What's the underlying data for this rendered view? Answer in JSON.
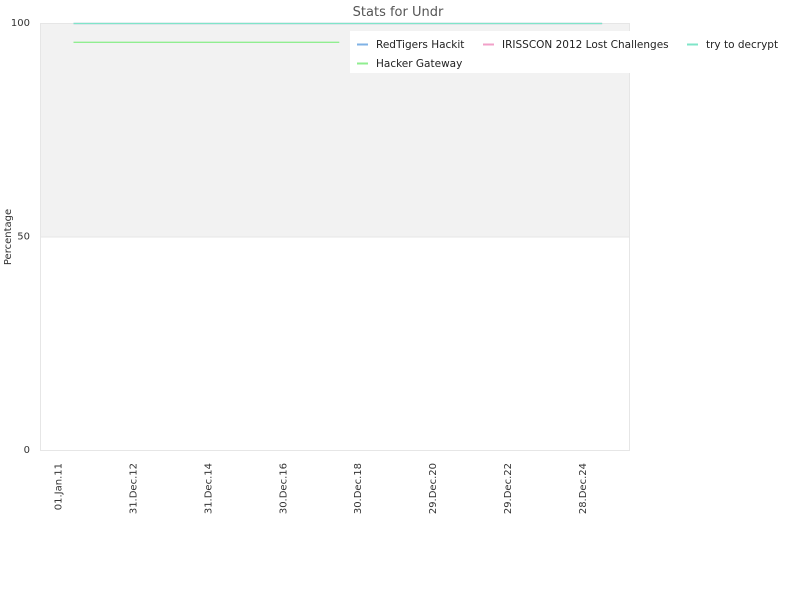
{
  "chart_data": {
    "type": "line",
    "title": "Stats for Undr",
    "xlabel": "",
    "ylabel": "Percentage",
    "ylim": [
      0,
      100
    ],
    "y_ticks": [
      0,
      50,
      100
    ],
    "x_tick_labels": [
      "01.Jan.11",
      "31.Dec.12",
      "31.Dec.14",
      "30.Dec.16",
      "30.Dec.18",
      "29.Dec.20",
      "29.Dec.22",
      "28.Dec.24"
    ],
    "x_range": [
      "2011-01-01",
      "2026-01-01"
    ],
    "grid": "horizontal",
    "legend_position": "top-right",
    "shaded_band": {
      "from": 50,
      "to": 100,
      "color": "#f2f2f2"
    },
    "series": [
      {
        "name": "RedTigers Hackit",
        "color": "#7fb2e5",
        "x": [
          "2011-06-01",
          "2025-06-30"
        ],
        "values": [
          100,
          100
        ]
      },
      {
        "name": "IRISSCON 2012 Lost Challenges",
        "color": "#f2a0c8",
        "x": [
          "2011-06-01",
          "2025-06-30"
        ],
        "values": [
          100,
          100
        ]
      },
      {
        "name": "try to decrypt",
        "color": "#7fe5c8",
        "x": [
          "2011-06-01",
          "2025-06-30"
        ],
        "values": [
          100,
          100
        ]
      },
      {
        "name": "Hacker Gateway",
        "color": "#90ee90",
        "x": [
          "2011-06-01",
          "2018-06-30"
        ],
        "values": [
          95.6,
          95.6
        ]
      }
    ]
  }
}
